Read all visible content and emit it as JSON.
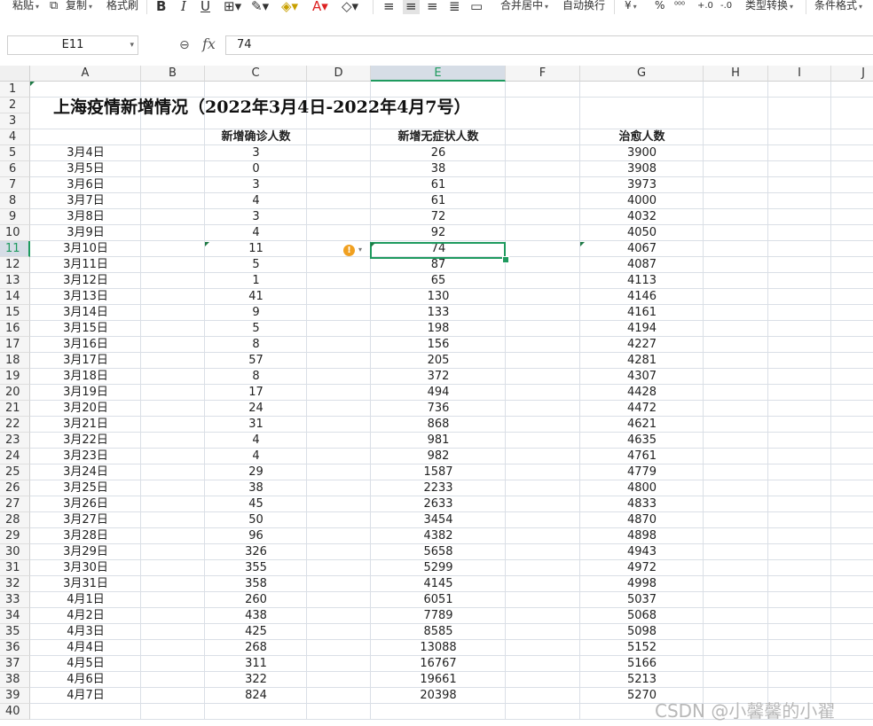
{
  "toolbar": {
    "paste": "粘贴",
    "copy": "复制",
    "format_painter": "格式刷",
    "merge_center": "合并居中",
    "wrap_text": "自动换行",
    "currency": "¥",
    "percent": "%",
    "type_convert": "类型转换",
    "conditional_format": "条件格式"
  },
  "formula_bar": {
    "name_box": "E11",
    "fx_label": "fx",
    "value": "74"
  },
  "columns": [
    "A",
    "B",
    "C",
    "D",
    "E",
    "F",
    "G",
    "H",
    "I",
    "J"
  ],
  "selected_cell": "E11",
  "title": "上海疫情新增情况（2022年3月4日-2022年4月7号）",
  "headers": {
    "confirmed": "新增确诊人数",
    "asymptomatic": "新增无症状人数",
    "recovered": "治愈人数"
  },
  "rows": [
    {
      "date": "3月4日",
      "confirmed": "3",
      "asymptomatic": "26",
      "recovered": "3900"
    },
    {
      "date": "3月5日",
      "confirmed": "0",
      "asymptomatic": "38",
      "recovered": "3908"
    },
    {
      "date": "3月6日",
      "confirmed": "3",
      "asymptomatic": "61",
      "recovered": "3973"
    },
    {
      "date": "3月7日",
      "confirmed": "4",
      "asymptomatic": "61",
      "recovered": "4000"
    },
    {
      "date": "3月8日",
      "confirmed": "3",
      "asymptomatic": "72",
      "recovered": "4032"
    },
    {
      "date": "3月9日",
      "confirmed": "4",
      "asymptomatic": "92",
      "recovered": "4050"
    },
    {
      "date": "3月10日",
      "confirmed": "11",
      "asymptomatic": "74",
      "recovered": "4067"
    },
    {
      "date": "3月11日",
      "confirmed": "5",
      "asymptomatic": "87",
      "recovered": "4087"
    },
    {
      "date": "3月12日",
      "confirmed": "1",
      "asymptomatic": "65",
      "recovered": "4113"
    },
    {
      "date": "3月13日",
      "confirmed": "41",
      "asymptomatic": "130",
      "recovered": "4146"
    },
    {
      "date": "3月14日",
      "confirmed": "9",
      "asymptomatic": "133",
      "recovered": "4161"
    },
    {
      "date": "3月15日",
      "confirmed": "5",
      "asymptomatic": "198",
      "recovered": "4194"
    },
    {
      "date": "3月16日",
      "confirmed": "8",
      "asymptomatic": "156",
      "recovered": "4227"
    },
    {
      "date": "3月17日",
      "confirmed": "57",
      "asymptomatic": "205",
      "recovered": "4281"
    },
    {
      "date": "3月18日",
      "confirmed": "8",
      "asymptomatic": "372",
      "recovered": "4307"
    },
    {
      "date": "3月19日",
      "confirmed": "17",
      "asymptomatic": "494",
      "recovered": "4428"
    },
    {
      "date": "3月20日",
      "confirmed": "24",
      "asymptomatic": "736",
      "recovered": "4472"
    },
    {
      "date": "3月21日",
      "confirmed": "31",
      "asymptomatic": "868",
      "recovered": "4621"
    },
    {
      "date": "3月22日",
      "confirmed": "4",
      "asymptomatic": "981",
      "recovered": "4635"
    },
    {
      "date": "3月23日",
      "confirmed": "4",
      "asymptomatic": "982",
      "recovered": "4761"
    },
    {
      "date": "3月24日",
      "confirmed": "29",
      "asymptomatic": "1587",
      "recovered": "4779"
    },
    {
      "date": "3月25日",
      "confirmed": "38",
      "asymptomatic": "2233",
      "recovered": "4800"
    },
    {
      "date": "3月26日",
      "confirmed": "45",
      "asymptomatic": "2633",
      "recovered": "4833"
    },
    {
      "date": "3月27日",
      "confirmed": "50",
      "asymptomatic": "3454",
      "recovered": "4870"
    },
    {
      "date": "3月28日",
      "confirmed": "96",
      "asymptomatic": "4382",
      "recovered": "4898"
    },
    {
      "date": "3月29日",
      "confirmed": "326",
      "asymptomatic": "5658",
      "recovered": "4943"
    },
    {
      "date": "3月30日",
      "confirmed": "355",
      "asymptomatic": "5299",
      "recovered": "4972"
    },
    {
      "date": "3月31日",
      "confirmed": "358",
      "asymptomatic": "4145",
      "recovered": "4998"
    },
    {
      "date": "4月1日",
      "confirmed": "260",
      "asymptomatic": "6051",
      "recovered": "5037"
    },
    {
      "date": "4月2日",
      "confirmed": "438",
      "asymptomatic": "7789",
      "recovered": "5068"
    },
    {
      "date": "4月3日",
      "confirmed": "425",
      "asymptomatic": "8585",
      "recovered": "5098"
    },
    {
      "date": "4月4日",
      "confirmed": "268",
      "asymptomatic": "13088",
      "recovered": "5152"
    },
    {
      "date": "4月5日",
      "confirmed": "311",
      "asymptomatic": "16767",
      "recovered": "5166"
    },
    {
      "date": "4月6日",
      "confirmed": "322",
      "asymptomatic": "19661",
      "recovered": "5213"
    },
    {
      "date": "4月7日",
      "confirmed": "824",
      "asymptomatic": "20398",
      "recovered": "5270"
    }
  ],
  "watermark": "CSDN @小馨馨的小翟",
  "colors": {
    "accent": "#1e9a5e",
    "grid": "#dadfe6",
    "warning": "#f0a020"
  }
}
